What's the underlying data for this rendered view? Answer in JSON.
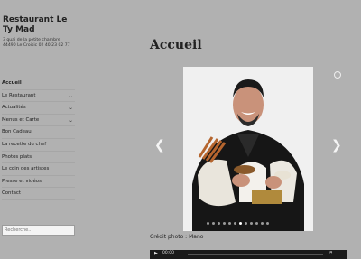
{
  "site": {
    "title": "Restaurant Le Ty Mad",
    "address_line1": "3 quai de la petite chambre",
    "address_line2": "44490 Le Croisic 02 40 23 02 77"
  },
  "menu": [
    {
      "label": "Accueil",
      "active": true,
      "has_children": false
    },
    {
      "label": "Le Restaurant",
      "has_children": true
    },
    {
      "label": "Actualités",
      "has_children": true
    },
    {
      "label": "Menus et Carte",
      "has_children": true
    },
    {
      "label": "Bon Cadeau",
      "has_children": false
    },
    {
      "label": "La recette du chef",
      "has_children": false
    },
    {
      "label": "Photos plats",
      "has_children": false
    },
    {
      "label": "Le coin des artistes",
      "has_children": false
    },
    {
      "label": "Presse et vidéos",
      "has_children": false
    },
    {
      "label": "Contact",
      "has_children": false
    }
  ],
  "search": {
    "placeholder": "Recherche..."
  },
  "main": {
    "title": "Accueil",
    "caption": "Crédit photo : Mano"
  },
  "player": {
    "time": "00:00"
  },
  "icons": {
    "prev": "chevron-left-icon",
    "next": "chevron-right-icon",
    "pause": "pause-icon"
  },
  "colors": {
    "background": "#b1b1b1"
  }
}
